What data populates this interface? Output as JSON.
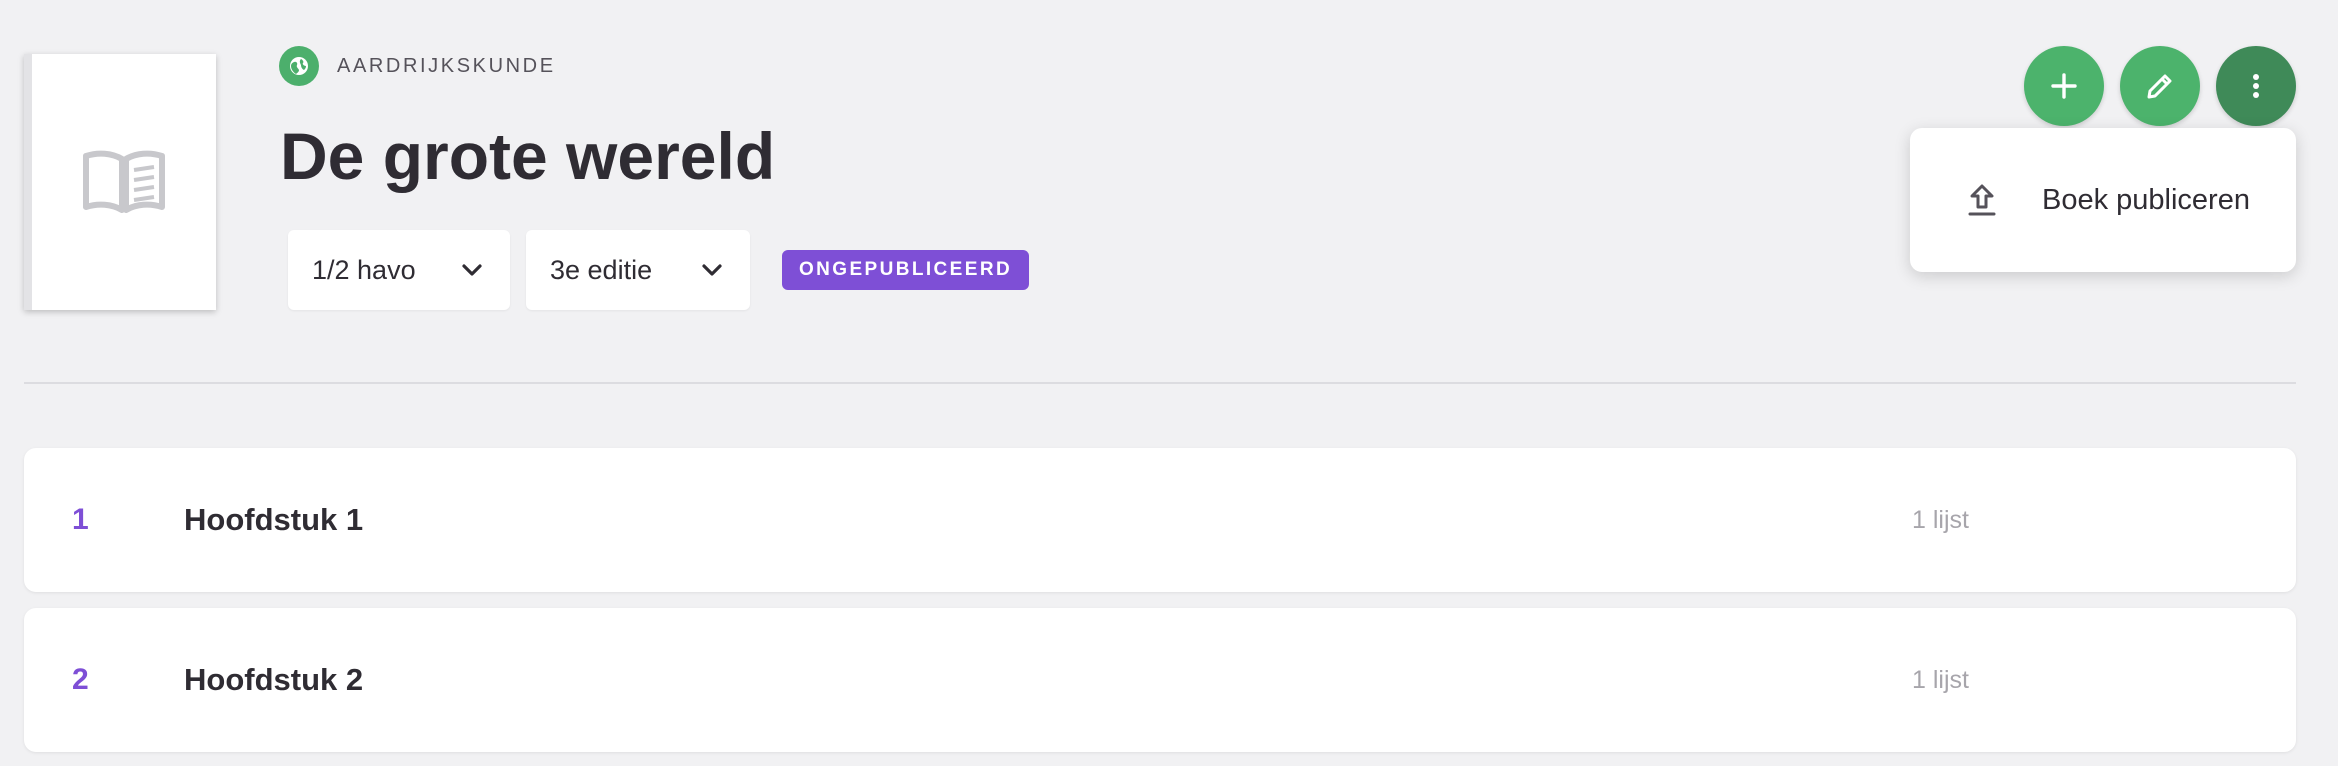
{
  "header": {
    "subject": "AARDRIJKSKUNDE",
    "subject_icon": "globe-icon",
    "title": "De grote wereld",
    "level_select": {
      "value": "1/2 havo",
      "icon": "chevron-down-icon"
    },
    "edition_select": {
      "value": "3e editie",
      "icon": "chevron-down-icon"
    },
    "status_badge": "ONGEPUBLICEERD"
  },
  "cover": {
    "icon": "open-book-icon"
  },
  "actions": {
    "add_icon": "plus-icon",
    "edit_icon": "pencil-icon",
    "more_icon": "more-vertical-icon"
  },
  "menu": {
    "items": [
      {
        "label": "Boek publiceren",
        "icon": "upload-icon"
      }
    ]
  },
  "chapters": [
    {
      "number": "1",
      "title": "Hoofdstuk 1",
      "count": "1 lijst"
    },
    {
      "number": "2",
      "title": "Hoofdstuk 2",
      "count": "1 lijst"
    }
  ],
  "colors": {
    "background": "#f1f1f3",
    "accent_green": "#4cb36c",
    "accent_green_dark": "#3f8a58",
    "accent_purple": "#7e4fd6",
    "text_primary": "#2f2c33",
    "text_muted": "#a7a5ab"
  }
}
